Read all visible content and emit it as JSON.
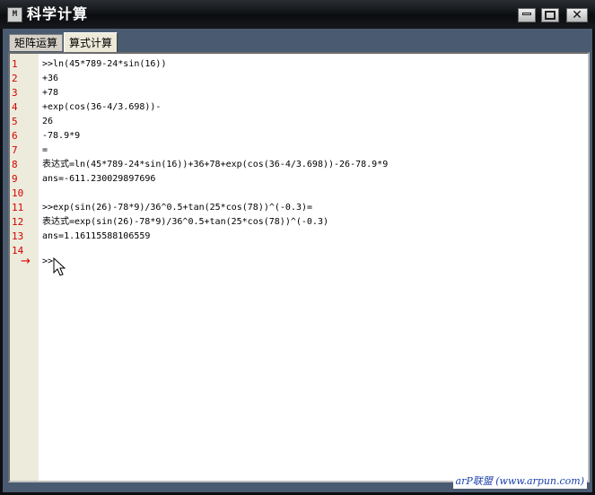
{
  "window": {
    "title": "科学计算",
    "app_icon_text": "M"
  },
  "tabs": [
    {
      "label": "矩阵运算",
      "active": false
    },
    {
      "label": "算式计算",
      "active": true
    }
  ],
  "editor": {
    "lines": [
      {
        "no": "1",
        "text": ">>ln(45*789-24*sin(16))"
      },
      {
        "no": "2",
        "text": "+36"
      },
      {
        "no": "3",
        "text": "+78"
      },
      {
        "no": "4",
        "text": "+exp(cos(36-4/3.698))-"
      },
      {
        "no": "5",
        "text": "26"
      },
      {
        "no": "6",
        "text": "-78.9*9"
      },
      {
        "no": "7",
        "text": "="
      },
      {
        "no": "8",
        "text": "表达式=ln(45*789-24*sin(16))+36+78+exp(cos(36-4/3.698))-26-78.9*9"
      },
      {
        "no": "9",
        "text": "ans=-611.230029897696"
      },
      {
        "no": "10",
        "text": ""
      },
      {
        "no": "11",
        "text": ">>exp(sin(26)-78*9)/36^0.5+tan(25*cos(78))^(-0.3)="
      },
      {
        "no": "12",
        "text": "表达式=exp(sin(26)-78*9)/36^0.5+tan(25*cos(78))^(-0.3)"
      },
      {
        "no": "13",
        "text": "ans=1.16115588106559"
      },
      {
        "no": "14",
        "text": ""
      }
    ],
    "prompt": ">>",
    "current_line_marker": "→"
  },
  "watermark": "arP联盟 (www.arpun.com)",
  "colors": {
    "line_number": "#d40000",
    "marker": "#e00000",
    "gutter": "#edecdc"
  }
}
